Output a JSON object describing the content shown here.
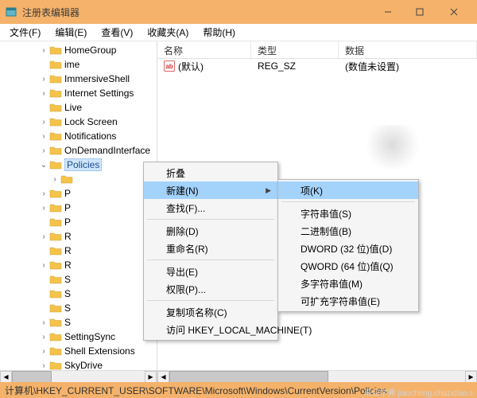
{
  "window": {
    "title": "注册表编辑器",
    "min": "–",
    "max": "▢",
    "close": "✕"
  },
  "menubar": [
    "文件(F)",
    "编辑(E)",
    "查看(V)",
    "收藏夹(A)",
    "帮助(H)"
  ],
  "tree": {
    "items": [
      {
        "depth": 3,
        "exp": ">",
        "label": "HomeGroup"
      },
      {
        "depth": 3,
        "exp": "",
        "label": "ime"
      },
      {
        "depth": 3,
        "exp": ">",
        "label": "ImmersiveShell"
      },
      {
        "depth": 3,
        "exp": ">",
        "label": "Internet Settings"
      },
      {
        "depth": 3,
        "exp": "",
        "label": "Live"
      },
      {
        "depth": 3,
        "exp": ">",
        "label": "Lock Screen"
      },
      {
        "depth": 3,
        "exp": ">",
        "label": "Notifications"
      },
      {
        "depth": 3,
        "exp": ">",
        "label": "OnDemandInterface"
      },
      {
        "depth": 3,
        "exp": "v",
        "label": "Policies",
        "selected": true
      },
      {
        "depth": 4,
        "exp": ">",
        "label": ""
      },
      {
        "depth": 3,
        "exp": ">",
        "label": "P"
      },
      {
        "depth": 3,
        "exp": ">",
        "label": "P"
      },
      {
        "depth": 3,
        "exp": "",
        "label": "P"
      },
      {
        "depth": 3,
        "exp": ">",
        "label": "R"
      },
      {
        "depth": 3,
        "exp": "",
        "label": "R"
      },
      {
        "depth": 3,
        "exp": ">",
        "label": "R"
      },
      {
        "depth": 3,
        "exp": "",
        "label": "S"
      },
      {
        "depth": 3,
        "exp": "",
        "label": "S"
      },
      {
        "depth": 3,
        "exp": "",
        "label": "S"
      },
      {
        "depth": 3,
        "exp": ">",
        "label": "S"
      },
      {
        "depth": 3,
        "exp": ">",
        "label": "SettingSync"
      },
      {
        "depth": 3,
        "exp": ">",
        "label": "Shell Extensions"
      },
      {
        "depth": 3,
        "exp": ">",
        "label": "SkyDrive"
      }
    ]
  },
  "list": {
    "columns": {
      "name": "名称",
      "type": "类型",
      "data": "数据"
    },
    "rows": [
      {
        "name": "(默认)",
        "type": "REG_SZ",
        "data": "(数值未设置)"
      }
    ]
  },
  "context1": {
    "items": [
      {
        "label": "折叠"
      },
      {
        "label": "新建(N)",
        "arrow": true,
        "highlight": true
      },
      {
        "label": "查找(F)..."
      },
      {
        "sep": true
      },
      {
        "label": "删除(D)"
      },
      {
        "label": "重命名(R)"
      },
      {
        "sep": true
      },
      {
        "label": "导出(E)"
      },
      {
        "label": "权限(P)..."
      },
      {
        "sep": true
      },
      {
        "label": "复制项名称(C)"
      },
      {
        "label": "访问 HKEY_LOCAL_MACHINE(T)"
      }
    ]
  },
  "context2": {
    "items": [
      {
        "label": "项(K)",
        "highlight": true
      },
      {
        "sep": true
      },
      {
        "label": "字符串值(S)"
      },
      {
        "label": "二进制值(B)"
      },
      {
        "label": "DWORD (32 位)值(D)"
      },
      {
        "label": "QWORD (64 位)值(Q)"
      },
      {
        "label": "多字符串值(M)"
      },
      {
        "label": "可扩充字符串值(E)"
      }
    ]
  },
  "statusbar": "计算机\\HKEY_CURRENT_USER\\SOFTWARE\\Microsoft\\Windows\\CurrentVersion\\Policies",
  "watermark": "来自学典 jiaocheng.chazidian.c"
}
